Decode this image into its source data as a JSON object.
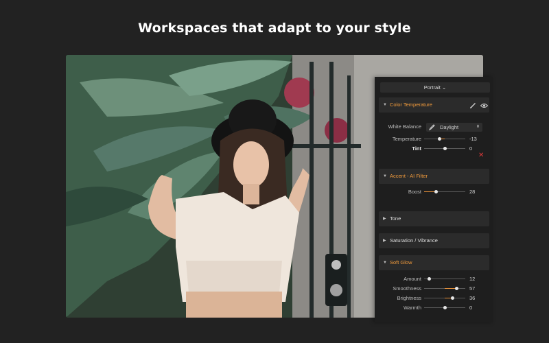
{
  "headline": "Workspaces that adapt to your style",
  "preset": {
    "label": "Portrait",
    "chevron": "⌄"
  },
  "colors": {
    "accent": "#f39c3c",
    "close": "#e03a3a",
    "panel_bg": "#1e1e1e"
  },
  "sections": {
    "color_temperature": {
      "title": "Color Temperature",
      "icons": [
        "brush-icon",
        "eye-icon"
      ],
      "white_balance": {
        "label": "White Balance",
        "value": "Daylight"
      },
      "sliders": [
        {
          "label": "Temperature",
          "value": "-13",
          "level": -0.13,
          "bold": false
        },
        {
          "label": "Tint",
          "value": "0",
          "level": 0,
          "bold": true
        }
      ]
    },
    "accent": {
      "title": "Accent - AI Filter",
      "sliders": [
        {
          "label": "Boost",
          "value": "28",
          "level": 0.28
        }
      ]
    },
    "tone": {
      "title": "Tone"
    },
    "saturation": {
      "title": "Saturation / Vibrance"
    },
    "soft_glow": {
      "title": "Soft Glow",
      "sliders": [
        {
          "label": "Amount",
          "value": "12",
          "level": 0.12
        },
        {
          "label": "Smoothness",
          "value": "57",
          "level": 0.57
        },
        {
          "label": "Brightness",
          "value": "36",
          "level": 0.36
        },
        {
          "label": "Warmth",
          "value": "0",
          "level": 0
        }
      ]
    }
  }
}
